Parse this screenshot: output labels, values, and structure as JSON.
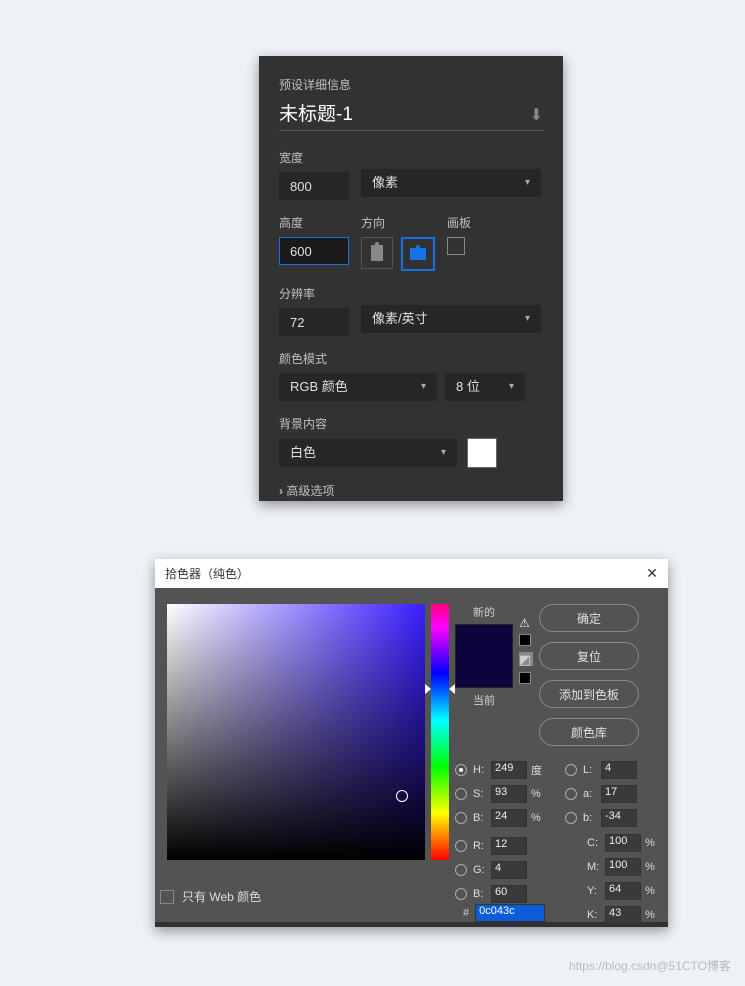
{
  "panel1": {
    "section_title": "预设详细信息",
    "doc_name": "未标题-1",
    "width_label": "宽度",
    "width_value": "800",
    "width_unit": "像素",
    "height_label": "高度",
    "height_value": "600",
    "orientation_label": "方向",
    "artboard_label": "画板",
    "res_label": "分辨率",
    "res_value": "72",
    "res_unit": "像素/英寸",
    "color_mode_label": "颜色模式",
    "color_mode": "RGB 颜色",
    "bit_depth": "8 位",
    "bg_label": "背景内容",
    "bg_value": "白色",
    "advanced": "高级选项"
  },
  "picker": {
    "title": "拾色器（纯色）",
    "new_label": "新的",
    "current_label": "当前",
    "buttons": {
      "ok": "确定",
      "reset": "复位",
      "add": "添加到色板",
      "lib": "颜色库"
    },
    "fields": {
      "H": "249",
      "H_unit": "度",
      "S": "93",
      "S_unit": "%",
      "B": "24",
      "B_unit": "%",
      "R": "12",
      "G": "4",
      "Bl": "60",
      "L": "4",
      "a": "17",
      "b": "-34",
      "C": "100",
      "M": "100",
      "Y": "64",
      "K": "43",
      "hex": "0c043c"
    },
    "web_only": "只有 Web 颜色"
  },
  "watermark": "https://blog.csdn@51CTO博客"
}
